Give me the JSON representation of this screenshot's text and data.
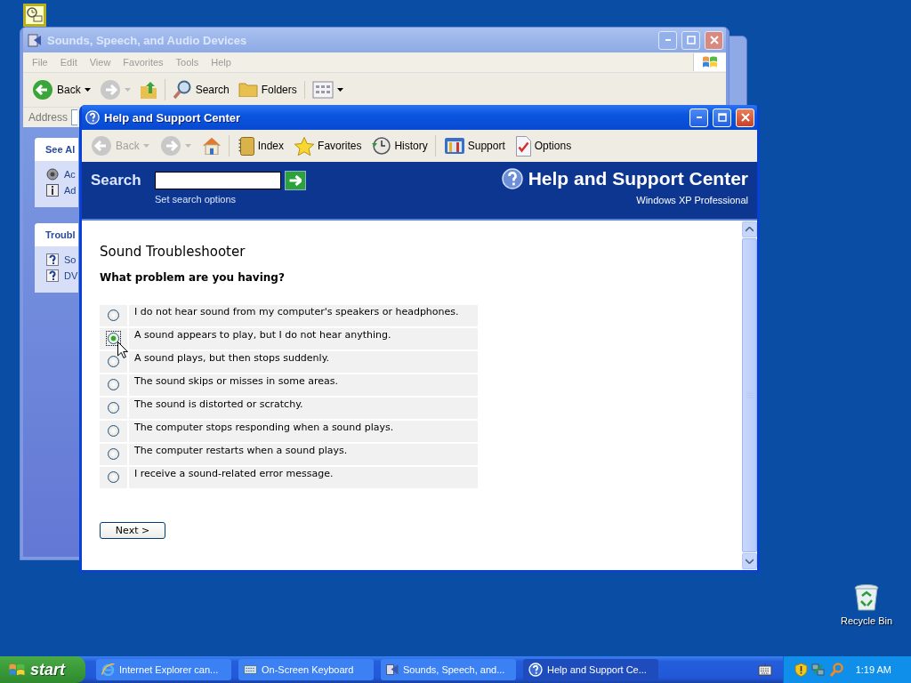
{
  "desktop_icons": [
    {
      "kind": "scheduled"
    },
    {
      "kind": "recycle",
      "label": "Recycle Bin"
    }
  ],
  "back_window": {
    "title": "Sounds, Speech, and Audio Devices",
    "menu": [
      "File",
      "Edit",
      "View",
      "Favorites",
      "Tools",
      "Help"
    ],
    "toolbar": [
      {
        "kind": "back",
        "label": "Back"
      },
      {
        "kind": "forward"
      },
      {
        "kind": "up"
      },
      {
        "kind": "search",
        "label": "Search"
      },
      {
        "kind": "folders",
        "label": "Folders"
      },
      {
        "kind": "views"
      }
    ],
    "address_label": "Address",
    "panels": [
      {
        "title": "See Al",
        "items": [
          {
            "kind": "speaker",
            "label": "Ac"
          },
          {
            "kind": "info",
            "label": "Ad"
          }
        ]
      },
      {
        "title": "Troubl",
        "items": [
          {
            "kind": "help",
            "label": "So"
          },
          {
            "kind": "help",
            "label": "DV"
          }
        ]
      }
    ]
  },
  "help_window": {
    "title": "Help and Support Center",
    "toolbar": [
      {
        "kind": "back",
        "label": "Back",
        "disabled": true
      },
      {
        "kind": "forward",
        "disabled": true
      },
      {
        "kind": "home"
      },
      {
        "kind": "index",
        "label": "Index"
      },
      {
        "kind": "favorites",
        "label": "Favorites"
      },
      {
        "kind": "history",
        "label": "History"
      },
      {
        "kind": "support",
        "label": "Support"
      },
      {
        "kind": "options",
        "label": "Options"
      }
    ],
    "search": {
      "label": "Search",
      "options_link": "Set search options"
    },
    "brand": {
      "title": "Help and Support Center",
      "edition": "Windows XP Professional"
    },
    "page": {
      "title": "Sound Troubleshooter",
      "question": "What problem are you having?",
      "options": [
        {
          "label": "I do not hear sound from my computer's speakers or headphones.",
          "selected": false
        },
        {
          "label": "A sound appears to play, but I do not hear anything.",
          "selected": true
        },
        {
          "label": "A sound plays, but then stops suddenly.",
          "selected": false
        },
        {
          "label": "The sound skips or misses in some areas.",
          "selected": false
        },
        {
          "label": "The sound is distorted or scratchy.",
          "selected": false
        },
        {
          "label": "The computer stops responding when a sound plays.",
          "selected": false
        },
        {
          "label": "The computer restarts when a sound plays.",
          "selected": false
        },
        {
          "label": "I receive a sound-related error message.",
          "selected": false
        }
      ],
      "next_button": "Next >"
    }
  },
  "taskbar": {
    "start_label": "start",
    "tasks": [
      {
        "kind": "ie",
        "label": "Internet Explorer can...",
        "selected": false
      },
      {
        "kind": "keyboard",
        "label": "On-Screen Keyboard",
        "selected": false
      },
      {
        "kind": "sounds",
        "label": "Sounds, Speech, and...",
        "selected": false
      },
      {
        "kind": "help",
        "label": "Help and Support Ce...",
        "selected": true
      }
    ],
    "clock": "1:19 AM"
  }
}
